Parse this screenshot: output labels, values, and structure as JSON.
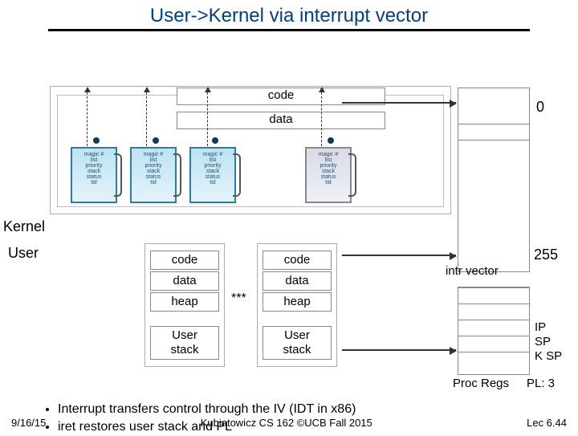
{
  "title": "User->Kernel via interrupt vector",
  "kernel": {
    "code_label": "code",
    "data_label": "data",
    "thread_text": "magic #\nlist\npriority\nstack\nstatus\ntid"
  },
  "labels": {
    "kernel": "Kernel",
    "user": "User",
    "intr_vector": "intr vector",
    "proc_regs": "Proc Regs",
    "stars": "***"
  },
  "user_proc": {
    "cells": [
      "code",
      "data",
      "heap"
    ],
    "stack_label": "User\nstack"
  },
  "vector": {
    "top": "0",
    "bottom": "255"
  },
  "regs": {
    "lines": [
      "IP",
      "SP",
      "K SP"
    ],
    "pl": "PL: 3"
  },
  "bullets": [
    "Interrupt transfers control through the IV (IDT in x86)",
    "iret restores user stack and PL"
  ],
  "footer": {
    "left": "9/16/15",
    "center": "Kubiatowicz CS 162 ©UCB Fall 2015",
    "right": "Lec 6.44"
  }
}
